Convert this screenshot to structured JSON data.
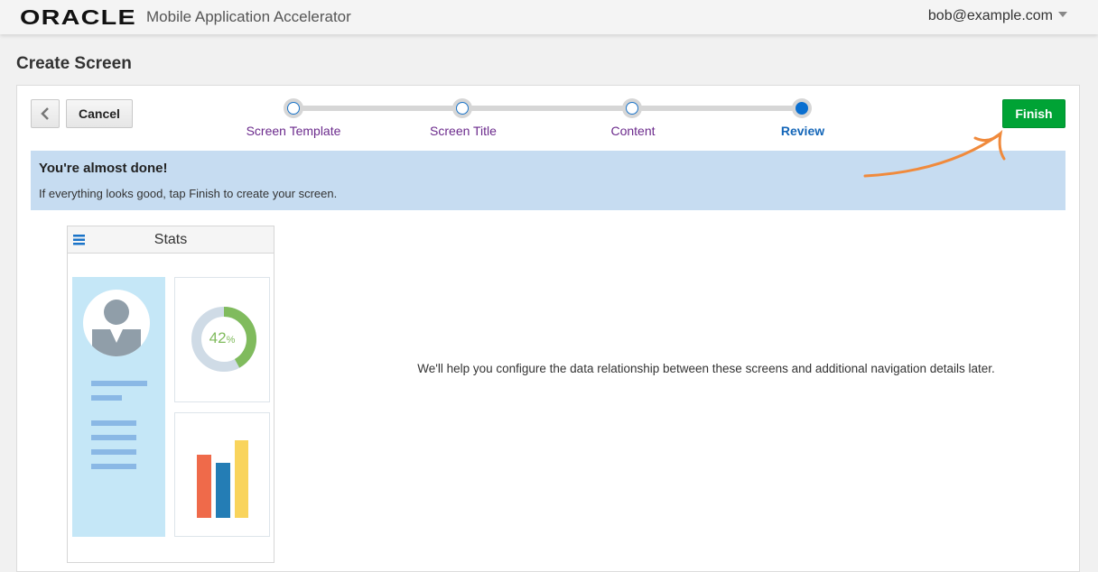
{
  "header": {
    "logo": "ORACLE",
    "app_name": "Mobile Application Accelerator",
    "user": "bob@example.com"
  },
  "page": {
    "title": "Create Screen"
  },
  "toolbar": {
    "cancel_label": "Cancel",
    "finish_label": "Finish"
  },
  "steps": [
    {
      "label": "Screen Template"
    },
    {
      "label": "Screen Title"
    },
    {
      "label": "Content"
    },
    {
      "label": "Review",
      "current": true
    }
  ],
  "banner": {
    "heading": "You're almost done!",
    "text": "If everything looks good, tap Finish to create your screen."
  },
  "preview": {
    "title": "Stats",
    "donut_value": "42",
    "donut_unit": "%",
    "donut_percent": 42
  },
  "message": "We'll help you configure the data relationship between these screens and additional navigation details later.",
  "colors": {
    "finish": "#00a335",
    "banner": "#c6dcf1",
    "accent": "#0a6fd0",
    "arrow": "#f08a3c"
  }
}
